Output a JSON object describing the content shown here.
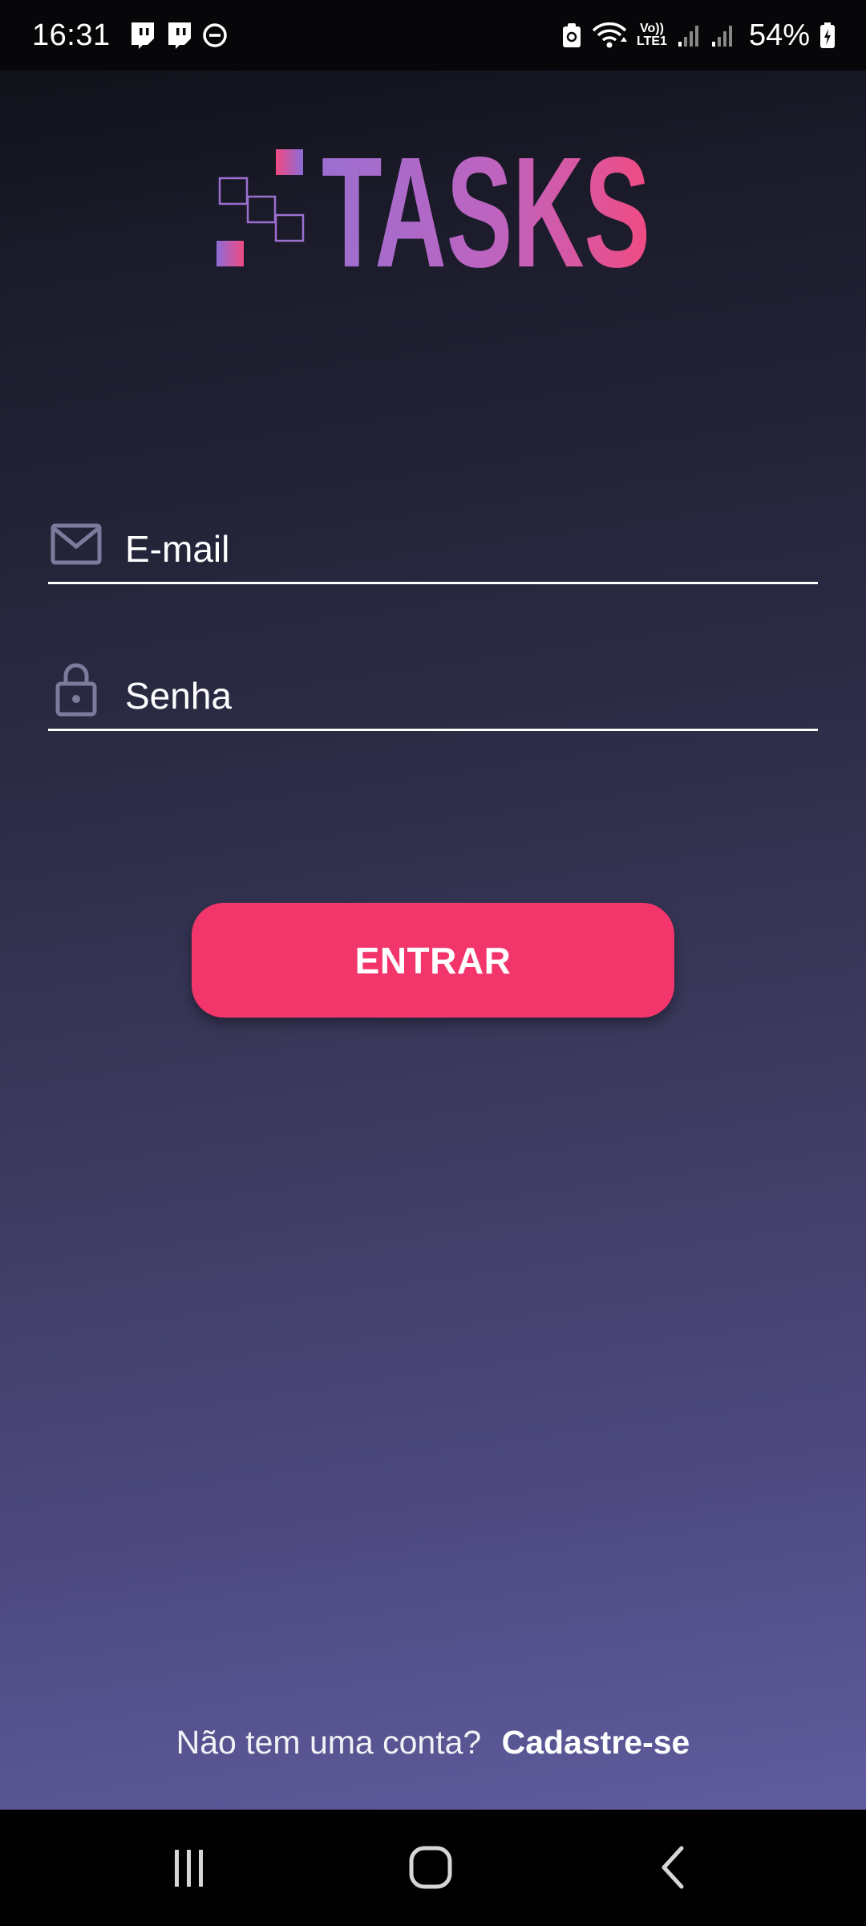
{
  "status_bar": {
    "time": "16:31",
    "battery": "54%",
    "network_label_top": "Vo))",
    "network_label_bottom": "LTE1",
    "icons": [
      "twitch-icon",
      "twitch-icon",
      "dnd-icon",
      "vpn-icon",
      "wifi-icon",
      "volte-icon",
      "signal-icon",
      "signal-icon",
      "battery-icon"
    ]
  },
  "logo": {
    "text": "TASKS",
    "gradient": [
      "#9b6fd0",
      "#c063bf",
      "#f04b82"
    ]
  },
  "form": {
    "email_label": "E-mail",
    "email_icon": "mail-icon",
    "password_label": "Senha",
    "password_icon": "lock-icon"
  },
  "login_button": {
    "label": "ENTRAR",
    "color": "#f2356a"
  },
  "signup": {
    "question": "Não tem uma conta?",
    "link": "Cadastre-se"
  },
  "nav_bar": {
    "items": [
      "recents-icon",
      "home-icon",
      "back-icon"
    ]
  }
}
